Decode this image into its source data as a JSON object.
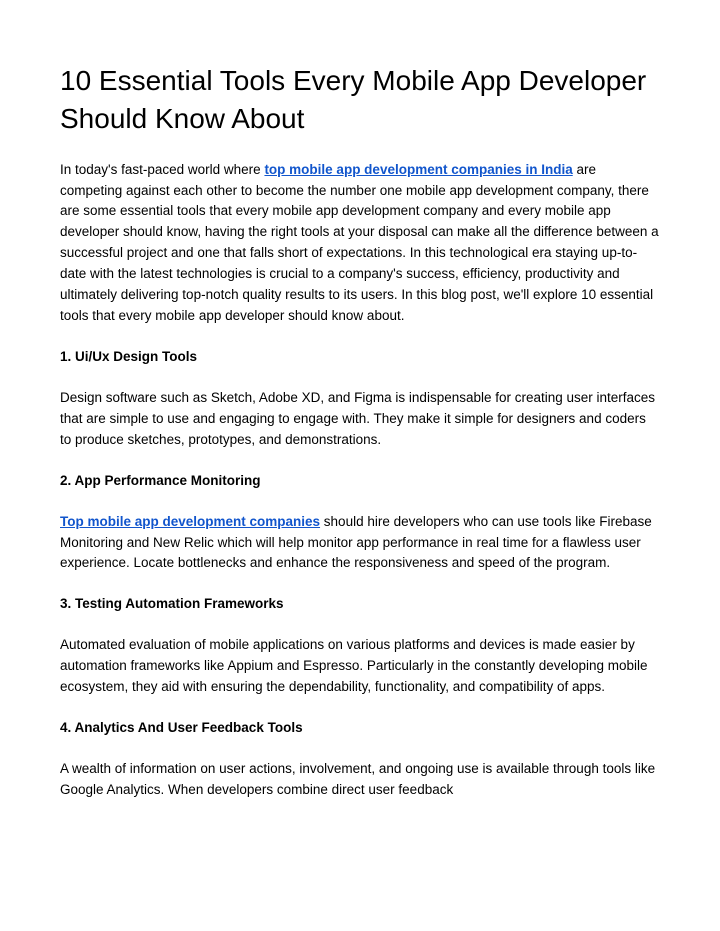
{
  "title": "10 Essential Tools Every Mobile App Developer Should Know About",
  "intro": {
    "pre": "In today's fast-paced world where ",
    "link": "top mobile app development companies in India",
    "post": " are competing against each other to become the number one mobile app development company, there are some essential tools that every mobile app development company and every mobile app developer should know, having the right tools at your disposal can make all the difference between a successful project and one that falls short of expectations. In this technological era staying up-to-date with the latest technologies is crucial to a company's success, efficiency, productivity and ultimately delivering top-notch quality results to its users. In this blog post, we'll explore 10 essential tools that every mobile app developer should know about."
  },
  "sections": {
    "s1": {
      "heading": "1. Ui/Ux Design Tools",
      "body": "Design software such as Sketch, Adobe XD, and Figma is indispensable for creating user interfaces that are simple to use and engaging to engage with. They make it simple for designers and coders to produce sketches, prototypes, and demonstrations."
    },
    "s2": {
      "heading": "2. App Performance Monitoring",
      "link": "Top mobile app development companies",
      "post": " should hire developers who can use tools like Firebase Monitoring and New Relic which will help monitor app performance in real time for a flawless user experience. Locate bottlenecks and enhance the responsiveness and speed of the program."
    },
    "s3": {
      "heading": "3. Testing Automation Frameworks",
      "body": "Automated evaluation of mobile applications on various platforms and devices is made easier by automation frameworks like Appium and Espresso. Particularly in the constantly developing mobile ecosystem, they aid with ensuring the dependability, functionality, and compatibility of apps."
    },
    "s4": {
      "heading": "4. Analytics And User Feedback Tools",
      "body": "A wealth of information on user actions, involvement, and ongoing use is available through tools like Google Analytics. When developers combine direct user feedback"
    }
  }
}
